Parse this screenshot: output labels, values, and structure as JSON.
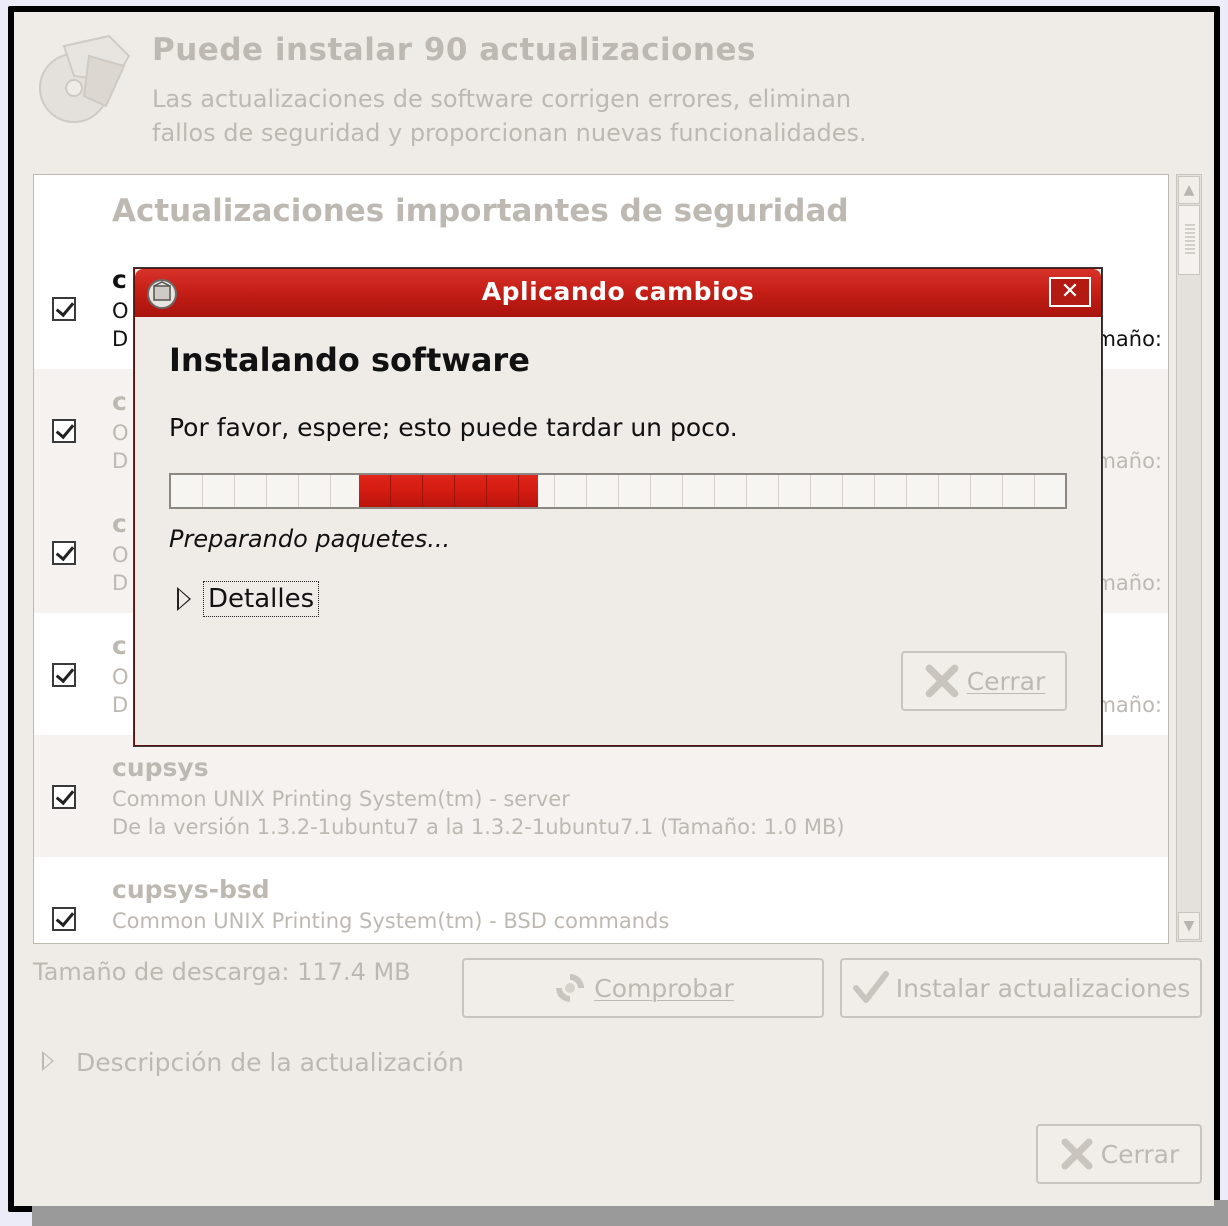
{
  "header": {
    "title": "Puede instalar 90 actualizaciones",
    "subtitle_line1": "Las actualizaciones de software corrigen errores, eliminan",
    "subtitle_line2": "fallos de seguridad y proporcionan nuevas funcionalidades.",
    "icon": "software-update-icon"
  },
  "list": {
    "section_heading": "Actualizaciones importantes de seguridad",
    "rows": [
      {
        "name_visible": "c",
        "desc_visible": "O",
        "ver_visible": "D",
        "size_tail": "maño:",
        "checked": true
      },
      {
        "name_visible": "c",
        "desc_visible": "O",
        "ver_visible": "D",
        "size_tail": "maño:",
        "checked": true
      },
      {
        "name_visible": "c",
        "desc_visible": "O",
        "ver_visible": "D",
        "size_tail": "maño:",
        "checked": true
      },
      {
        "name_visible": "c",
        "desc_visible": "O",
        "ver_visible": "D",
        "size_tail": "maño:",
        "checked": true
      },
      {
        "name": "cupsys",
        "desc": "Common UNIX Printing System(tm) - server",
        "ver": "De la versión 1.3.2-1ubuntu7 a la 1.3.2-1ubuntu7.1 (Tamaño: 1.0 MB)",
        "checked": true
      },
      {
        "name": "cupsys-bsd",
        "desc": "Common UNIX Printing System(tm) - BSD commands",
        "checked": true
      }
    ]
  },
  "footer": {
    "download_size": "Tamaño de descarga: 117.4 MB",
    "check_button": "Comprobar",
    "install_button": "Instalar actualizaciones",
    "description_expander": "Descripción de la actualización",
    "close_button": "Cerrar"
  },
  "dialog": {
    "title": "Aplicando cambios",
    "close_x": "✕",
    "heading": "Instalando software",
    "message": "Por favor, espere; esto puede tardar un poco.",
    "progress_fraction": 0.2,
    "progress_offset_fraction": 0.21,
    "status": "Preparando paquetes...",
    "details_label": "Detalles",
    "close_button": "Cerrar",
    "accent_color": "#c51f17"
  }
}
